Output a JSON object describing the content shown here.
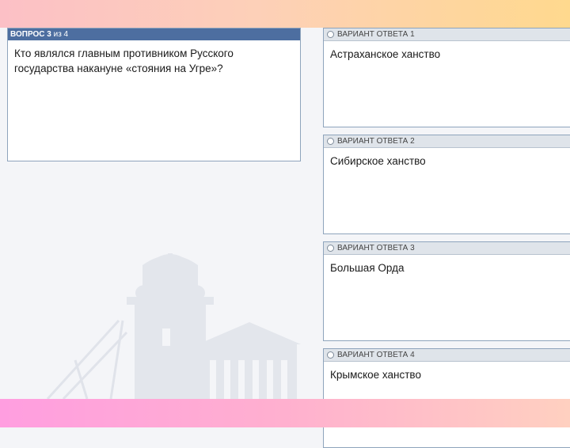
{
  "question": {
    "header_bold": "ВОПРОС 3",
    "header_rest": "из 4",
    "text": "Кто являлся главным противником Русского государства накануне «стояния на Угре»?"
  },
  "answers": [
    {
      "label": "ВАРИАНТ ОТВЕТА 1",
      "text": "Астраханское ханство"
    },
    {
      "label": "ВАРИАНТ ОТВЕТА 2",
      "text": "Сибирское ханство"
    },
    {
      "label": "ВАРИАНТ ОТВЕТА 3",
      "text": "Большая Орда"
    },
    {
      "label": "ВАРИАНТ ОТВЕТА 4",
      "text": "Крымское ханство"
    }
  ],
  "colors": {
    "question_header": "#4d6ea0",
    "answer_header": "#dfe4ea",
    "border": "#8ea4bc"
  }
}
